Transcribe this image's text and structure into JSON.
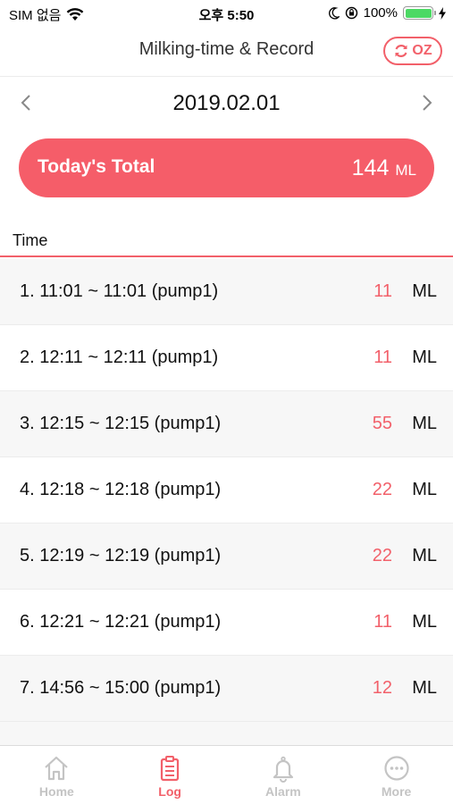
{
  "status_bar": {
    "carrier": "SIM 없음",
    "time": "오후 5:50",
    "battery_percent": "100%",
    "battery_level": 1.0
  },
  "header": {
    "title": "Milking-time & Record",
    "oz_label": "OZ"
  },
  "date_nav": {
    "date": "2019.02.01"
  },
  "total": {
    "label": "Today's Total",
    "value": "144",
    "unit": "ML"
  },
  "list": {
    "column_header": "Time",
    "records": [
      {
        "text": "1. 11:01 ~ 11:01 (pump1)",
        "amount": "11",
        "unit": "ML"
      },
      {
        "text": "2. 12:11 ~ 12:11 (pump1)",
        "amount": "11",
        "unit": "ML"
      },
      {
        "text": "3. 12:15 ~ 12:15 (pump1)",
        "amount": "55",
        "unit": "ML"
      },
      {
        "text": "4. 12:18 ~ 12:18 (pump1)",
        "amount": "22",
        "unit": "ML"
      },
      {
        "text": "5. 12:19 ~ 12:19 (pump1)",
        "amount": "22",
        "unit": "ML"
      },
      {
        "text": "6. 12:21 ~ 12:21 (pump1)",
        "amount": "11",
        "unit": "ML"
      },
      {
        "text": "7. 14:56 ~ 15:00 (pump1)",
        "amount": "12",
        "unit": "ML"
      }
    ]
  },
  "tabs": [
    {
      "label": "Home",
      "icon": "home-icon",
      "active": false
    },
    {
      "label": "Log",
      "icon": "clipboard-icon",
      "active": true
    },
    {
      "label": "Alarm",
      "icon": "bell-icon",
      "active": false
    },
    {
      "label": "More",
      "icon": "more-icon",
      "active": false
    }
  ],
  "colors": {
    "accent": "#f2606a",
    "pill": "#f55d69",
    "inactive_tab": "#c4c4c4",
    "battery": "#4cd964"
  }
}
